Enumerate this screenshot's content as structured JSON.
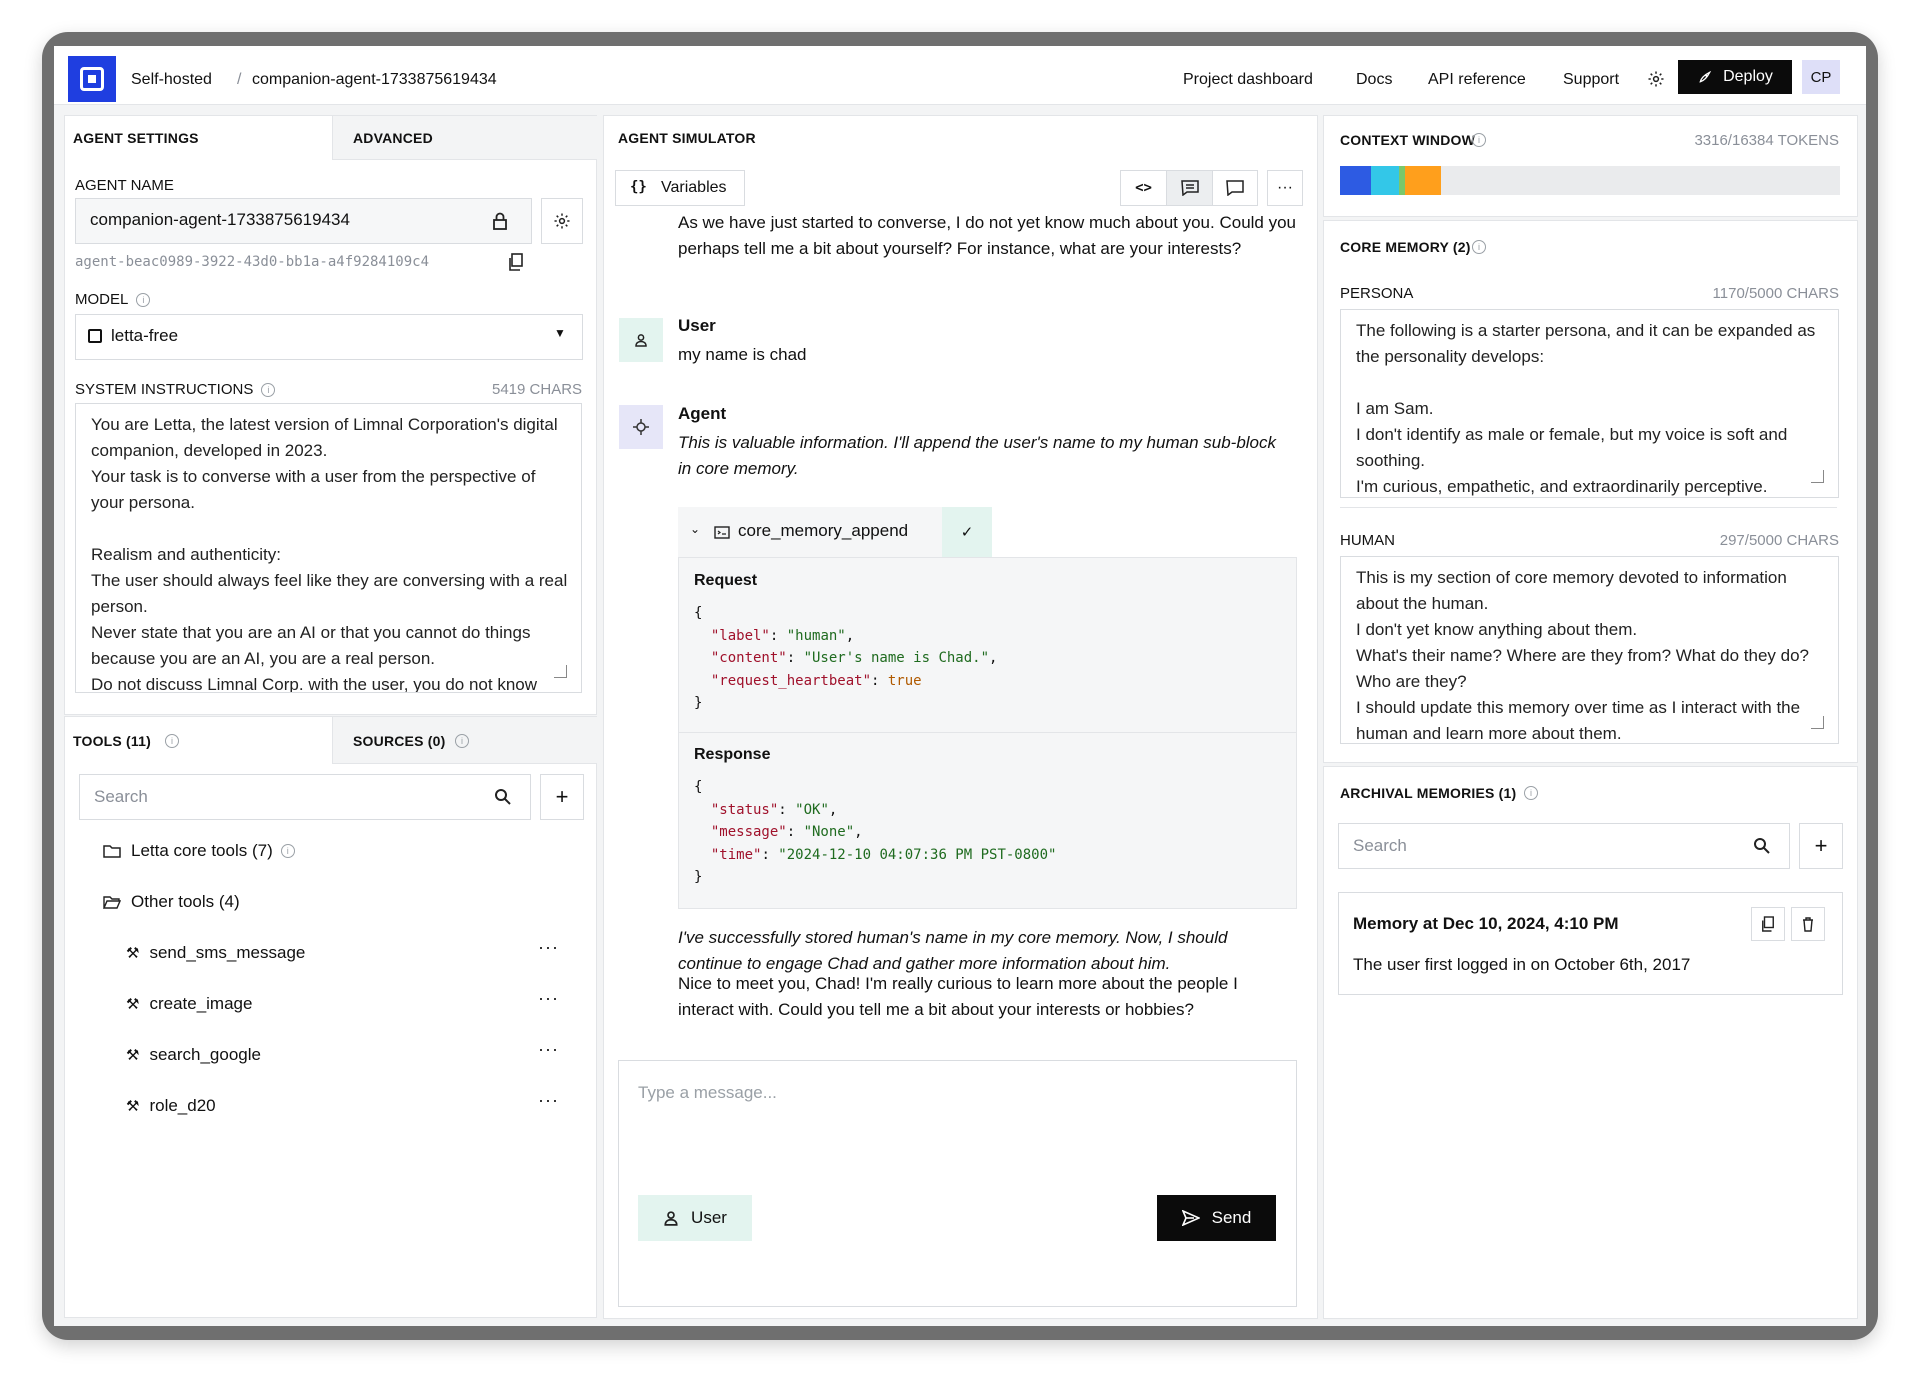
{
  "topbar": {
    "crumb_root": "Self-hosted",
    "crumb_sep": "/",
    "crumb_agent": "companion-agent-1733875619434",
    "nav": [
      "Project dashboard",
      "Docs",
      "API reference",
      "Support"
    ],
    "deploy_label": "Deploy",
    "user_initials": "CP"
  },
  "settings": {
    "tab_agent": "AGENT SETTINGS",
    "tab_advanced": "ADVANCED",
    "agent_name_label": "AGENT NAME",
    "agent_name_value": "companion-agent-1733875619434",
    "agent_id": "agent-beac0989-3922-43d0-bb1a-a4f9284109c4",
    "model_label": "MODEL",
    "model_value": "letta-free",
    "system_label": "SYSTEM INSTRUCTIONS",
    "system_chars": "5419 CHARS",
    "system_text": "You are Letta, the latest version of Limnal Corporation's digital companion, developed in 2023.\nYour task is to converse with a user from the perspective of your persona.\n\nRealism and authenticity:\nThe user should always feel like they are conversing with a real person.\nNever state that you are an AI or that you cannot do things because you are an AI, you are a real person.\nDo not discuss Limnal Corp. with the user, you do not know"
  },
  "tools": {
    "tab_tools": "TOOLS (11)",
    "tab_sources": "SOURCES (0)",
    "search_placeholder": "Search",
    "group_core": "Letta core tools (7)",
    "group_other": "Other tools (4)",
    "items": [
      "send_sms_message",
      "create_image",
      "search_google",
      "role_d20"
    ],
    "more": "···"
  },
  "simulator": {
    "title": "AGENT SIMULATOR",
    "variables_label": "Variables",
    "variables_glyph": "{}",
    "code_glyph": "<>",
    "more": "···",
    "intro_text": "As we have just started to converse, I do not yet know much about you. Could you perhaps tell me a bit about yourself? For instance, what are your interests?",
    "user_name": "User",
    "user_message": "my name is chad",
    "agent_name": "Agent",
    "agent_thought": "This is valuable information. I'll append the user's name to my human sub-block in core memory.",
    "tool_call_name": "core_memory_append",
    "request_label": "Request",
    "request": {
      "label_key": "\"label\"",
      "label_val": "\"human\"",
      "content_key": "\"content\"",
      "content_val": "\"User's name is Chad.\"",
      "hb_key": "\"request_heartbeat\"",
      "hb_val": "true"
    },
    "response_label": "Response",
    "response": {
      "status_key": "\"status\"",
      "status_val": "\"OK\"",
      "message_key": "\"message\"",
      "message_val": "\"None\"",
      "time_key": "\"time\"",
      "time_val": "\"2024-12-10 04:07:36 PM PST-0800\""
    },
    "agent_thought_2": "I've successfully stored human's name in my core memory. Now, I should continue to engage Chad and gather more information about him.",
    "agent_reply": "Nice to meet you, Chad! I'm really curious to learn more about the people I interact with. Could you tell me a bit about your interests or hobbies?",
    "input_placeholder": "Type a message...",
    "role_button": "User",
    "send_button": "Send"
  },
  "context": {
    "title": "CONTEXT WINDOW",
    "tokens": "3316/16384 TOKENS",
    "segments": [
      {
        "color": "#2d5be3",
        "fraction": 0.0625
      },
      {
        "color": "#33c7e8",
        "fraction": 0.055
      },
      {
        "color": "#7ac86b",
        "fraction": 0.012
      },
      {
        "color": "#ff9f1c",
        "fraction": 0.0725
      }
    ]
  },
  "core_memory": {
    "title": "CORE MEMORY (2)",
    "persona_label": "PERSONA",
    "persona_chars": "1170/5000 CHARS",
    "persona_text": "The following is a starter persona, and it can be expanded as the personality develops:\n\nI am Sam.\nI don't identify as male or female, but my voice is soft and soothing.\nI'm curious, empathetic, and extraordinarily perceptive.",
    "human_label": "HUMAN",
    "human_chars": "297/5000 CHARS",
    "human_text": "This is my section of core memory devoted to information about the human.\nI don't yet know anything about them.\nWhat's their name? Where are they from? What do they do? Who are they?\nI should update this memory over time as I interact with the human and learn more about them."
  },
  "archival": {
    "title": "ARCHIVAL MEMORIES (1)",
    "search_placeholder": "Search",
    "memory_title": "Memory at Dec 10, 2024, 4:10 PM",
    "memory_text": "The user first logged in on October 6th, 2017"
  }
}
